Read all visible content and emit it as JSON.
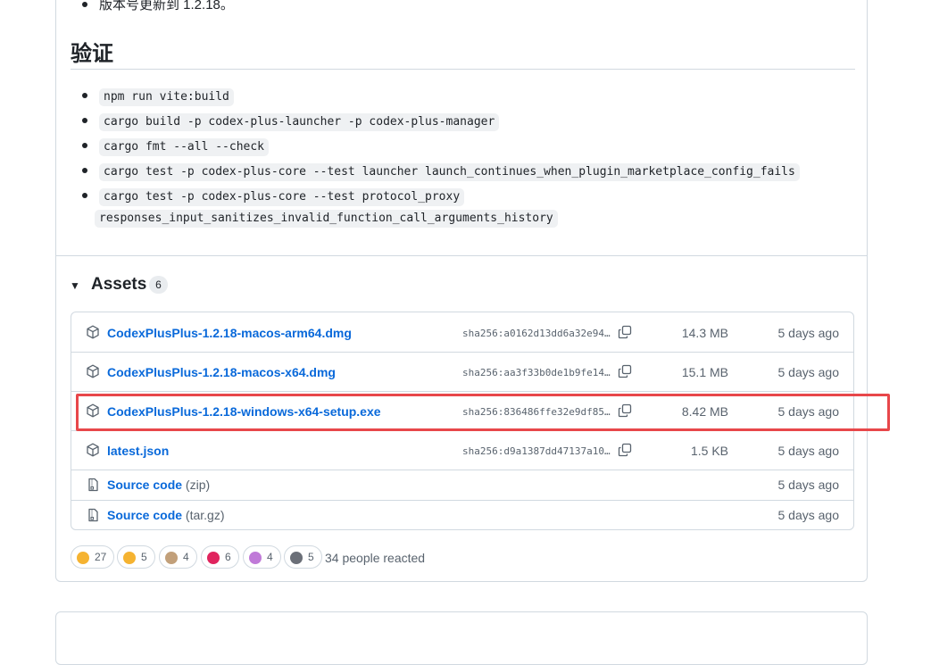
{
  "top_bullet": "版本号更新到 1.2.18。",
  "verify": {
    "heading": "验证",
    "commands": [
      "npm run vite:build",
      "cargo build -p codex-plus-launcher -p codex-plus-manager",
      "cargo fmt --all --check",
      "cargo test -p codex-plus-core --test launcher launch_continues_when_plugin_marketplace_config_fails",
      "cargo test -p codex-plus-core --test protocol_proxy",
      "responses_input_sanitizes_invalid_function_call_arguments_history"
    ]
  },
  "assets": {
    "toggle": "▼",
    "title": "Assets",
    "count": "6",
    "files": [
      {
        "name": "CodexPlusPlus-1.2.18-macos-arm64.dmg",
        "sha": "sha256:a0162d13dd6a32e94…",
        "size": "14.3 MB",
        "date": "5 days ago",
        "icon": "package-icon"
      },
      {
        "name": "CodexPlusPlus-1.2.18-macos-x64.dmg",
        "sha": "sha256:aa3f33b0de1b9fe14…",
        "size": "15.1 MB",
        "date": "5 days ago",
        "icon": "package-icon"
      },
      {
        "name": "CodexPlusPlus-1.2.18-windows-x64-setup.exe",
        "sha": "sha256:836486ffe32e9df85…",
        "size": "8.42 MB",
        "date": "5 days ago",
        "icon": "package-icon"
      },
      {
        "name": "latest.json",
        "sha": "sha256:d9a1387dd47137a10…",
        "size": "1.5 KB",
        "date": "5 days ago",
        "icon": "package-icon"
      }
    ],
    "sources": [
      {
        "name": "Source code",
        "sub": "(zip)",
        "date": "5 days ago",
        "icon": "file-zip-icon"
      },
      {
        "name": "Source code",
        "sub": "(tar.gz)",
        "date": "5 days ago",
        "icon": "file-zip-icon"
      }
    ]
  },
  "reactions": [
    {
      "emoji": "thumbs-up",
      "count": "27",
      "color": "#f5b331"
    },
    {
      "emoji": "laugh",
      "count": "5",
      "color": "#f5b331"
    },
    {
      "emoji": "hooray",
      "count": "4",
      "color": "#c2a07a"
    },
    {
      "emoji": "heart",
      "count": "6",
      "color": "#e0245e"
    },
    {
      "emoji": "rocket",
      "count": "4",
      "color": "#c07ad8"
    },
    {
      "emoji": "eyes",
      "count": "5",
      "color": "#6b6f78"
    }
  ],
  "reacted_text": "34 people reacted",
  "colors": {
    "link": "#0969da",
    "highlight": "#e8474a",
    "border": "#d1d9e0"
  }
}
